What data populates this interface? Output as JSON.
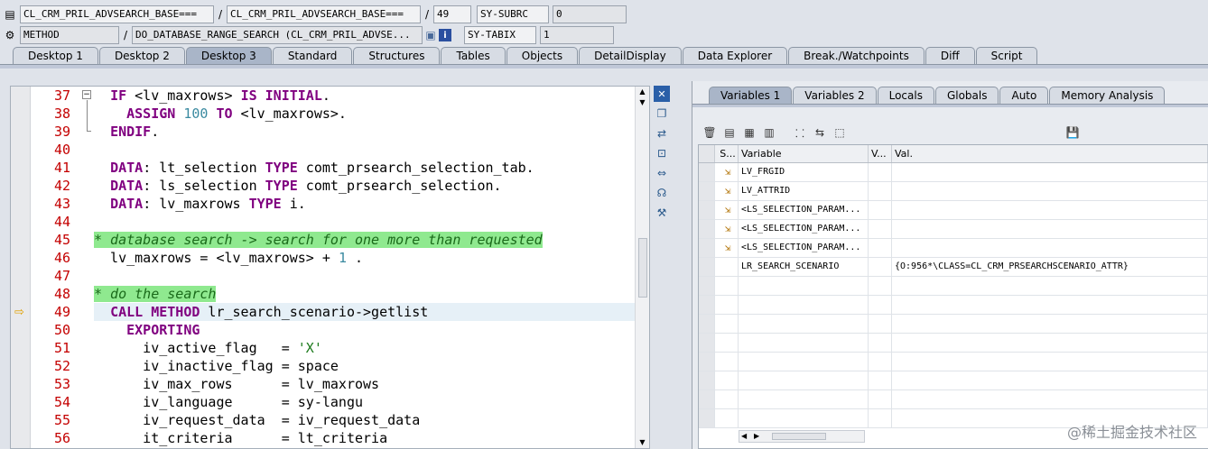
{
  "header": {
    "row1": {
      "program": "CL_CRM_PRIL_ADVSEARCH_BASE===",
      "include": "CL_CRM_PRIL_ADVSEARCH_BASE===",
      "line": "49",
      "var_name": "SY-SUBRC",
      "var_value": "0"
    },
    "row2": {
      "type": "METHOD",
      "name": "DO_DATABASE_RANGE_SEARCH (CL_CRM_PRIL_ADVSE...",
      "var_name": "SY-TABIX",
      "var_value": "1"
    },
    "sep": "/"
  },
  "tabs": [
    "Desktop 1",
    "Desktop 2",
    "Desktop 3",
    "Standard",
    "Structures",
    "Tables",
    "Objects",
    "DetailDisplay",
    "Data Explorer",
    "Break./Watchpoints",
    "Diff",
    "Script"
  ],
  "active_tab": "Desktop 3",
  "editor": {
    "line_numbers": [
      "37",
      "38",
      "39",
      "40",
      "41",
      "42",
      "43",
      "44",
      "45",
      "46",
      "47",
      "48",
      "49",
      "50",
      "51",
      "52",
      "53",
      "54",
      "55",
      "56"
    ],
    "current_line": "49"
  },
  "right": {
    "tabs": [
      "Variables 1",
      "Variables 2",
      "Locals",
      "Globals",
      "Auto",
      "Memory Analysis"
    ],
    "active_tab": "Variables 1",
    "columns": {
      "s": "S...",
      "variable": "Variable",
      "v": "V...",
      "val": "Val."
    },
    "rows": [
      {
        "variable": "LV_FRGID",
        "val": ""
      },
      {
        "variable": "LV_ATTRID",
        "val": ""
      },
      {
        "variable": "<LS_SELECTION_PARAM...",
        "val": ""
      },
      {
        "variable": "<LS_SELECTION_PARAM...",
        "val": ""
      },
      {
        "variable": "<LS_SELECTION_PARAM...",
        "val": ""
      },
      {
        "variable": "LR_SEARCH_SCENARIO",
        "val": "{O:956*\\CLASS=CL_CRM_PRSEARCHSCENARIO_ATTR}"
      }
    ]
  },
  "watermark": "@稀土掘金技术社区"
}
